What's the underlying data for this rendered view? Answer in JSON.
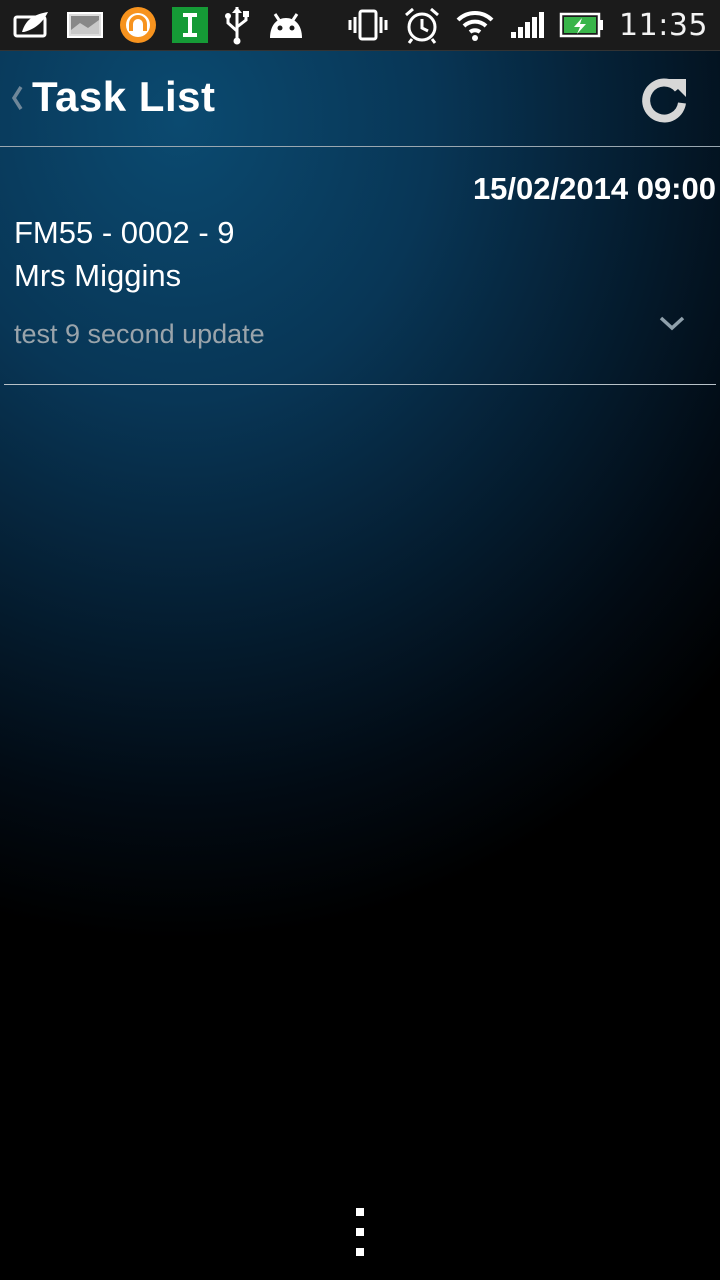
{
  "status_bar": {
    "time": "11:35",
    "icons_left": [
      "evernote-icon",
      "image-notification-icon",
      "orange-app-icon",
      "green-i-app-icon",
      "usb-icon",
      "android-debug-icon"
    ],
    "icons_right": [
      "vibrate-icon",
      "alarm-icon",
      "wifi-icon",
      "signal-icon",
      "battery-charging-icon"
    ]
  },
  "header": {
    "title": "Task List",
    "back_icon": "chevron-left-icon",
    "refresh_icon": "refresh-icon"
  },
  "tasks": [
    {
      "datetime": "15/02/2014 09:00",
      "reference": "FM55 - 0002 - 9",
      "name": "Mrs Miggins",
      "note": "test 9 second update",
      "expand_icon": "chevron-down-icon"
    }
  ],
  "menu": {
    "overflow_icon": "overflow-menu-icon"
  },
  "colors": {
    "accent_blue": "#0b4a70",
    "note_gray": "#9aa4ab",
    "divider": "#b8c2c8"
  }
}
